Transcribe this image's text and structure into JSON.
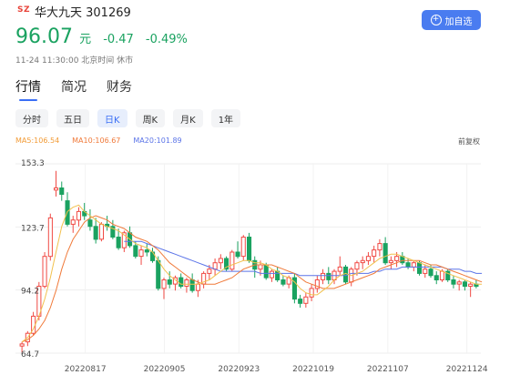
{
  "stock": {
    "exchange": "SZ",
    "name": "华大九天 301269",
    "price": "96.07",
    "unit": "元",
    "change": "-0.47",
    "change_pct": "-0.49%",
    "meta": "11-24 11:30:00 北京时间 休市",
    "add_watch_label": "加自选"
  },
  "main_tabs": [
    {
      "label": "行情",
      "active": true
    },
    {
      "label": "简况",
      "active": false
    },
    {
      "label": "财务",
      "active": false
    }
  ],
  "period_tabs": [
    {
      "label": "分时",
      "active": false
    },
    {
      "label": "五日",
      "active": false
    },
    {
      "label": "日K",
      "active": true
    },
    {
      "label": "周K",
      "active": false
    },
    {
      "label": "月K",
      "active": false
    },
    {
      "label": "1年",
      "active": false
    }
  ],
  "ma": {
    "ma5": "MA5:106.54",
    "ma10": "MA10:106.67",
    "ma20": "MA20:101.89",
    "adjust_label": "前复权"
  },
  "colors": {
    "up": "#f04a44",
    "down": "#1aa260",
    "ma5": "#f2c14e",
    "ma10": "#f07a3a",
    "ma20": "#5b74e8",
    "accent": "#3b6ff5"
  },
  "chart_data": {
    "type": "candlestick",
    "y_ticks": [
      "153.3",
      "123.7",
      "94.2",
      "64.7"
    ],
    "ylim": [
      64.7,
      153.3
    ],
    "x_ticks": [
      "20220817",
      "20220905",
      "20220923",
      "20221019",
      "20221107",
      "20221124"
    ],
    "candles": [
      {
        "o": 68,
        "h": 70,
        "l": 65,
        "c": 69
      },
      {
        "o": 70,
        "h": 75,
        "l": 68,
        "c": 74
      },
      {
        "o": 74,
        "h": 84,
        "l": 73,
        "c": 82
      },
      {
        "o": 82,
        "h": 98,
        "l": 80,
        "c": 96
      },
      {
        "o": 96,
        "h": 112,
        "l": 95,
        "c": 110
      },
      {
        "o": 110,
        "h": 130,
        "l": 108,
        "c": 128
      },
      {
        "o": 141,
        "h": 150,
        "l": 138,
        "c": 142
      },
      {
        "o": 142,
        "h": 145,
        "l": 136,
        "c": 139
      },
      {
        "o": 136,
        "h": 140,
        "l": 124,
        "c": 125
      },
      {
        "o": 125,
        "h": 129,
        "l": 121,
        "c": 127
      },
      {
        "o": 127,
        "h": 133,
        "l": 124,
        "c": 131
      },
      {
        "o": 131,
        "h": 135,
        "l": 127,
        "c": 129
      },
      {
        "o": 127,
        "h": 132,
        "l": 122,
        "c": 124
      },
      {
        "o": 124,
        "h": 128,
        "l": 116,
        "c": 118
      },
      {
        "o": 118,
        "h": 126,
        "l": 117,
        "c": 125
      },
      {
        "o": 125,
        "h": 129,
        "l": 122,
        "c": 124
      },
      {
        "o": 124,
        "h": 127,
        "l": 118,
        "c": 119
      },
      {
        "o": 119,
        "h": 123,
        "l": 113,
        "c": 114
      },
      {
        "o": 114,
        "h": 122,
        "l": 112,
        "c": 121
      },
      {
        "o": 121,
        "h": 124,
        "l": 114,
        "c": 115
      },
      {
        "o": 115,
        "h": 117,
        "l": 109,
        "c": 110
      },
      {
        "o": 110,
        "h": 115,
        "l": 106,
        "c": 113
      },
      {
        "o": 113,
        "h": 116,
        "l": 110,
        "c": 112
      },
      {
        "o": 112,
        "h": 114,
        "l": 107,
        "c": 108
      },
      {
        "o": 108,
        "h": 110,
        "l": 94,
        "c": 95
      },
      {
        "o": 95,
        "h": 100,
        "l": 90,
        "c": 99
      },
      {
        "o": 99,
        "h": 103,
        "l": 95,
        "c": 97
      },
      {
        "o": 97,
        "h": 101,
        "l": 94,
        "c": 100
      },
      {
        "o": 100,
        "h": 102,
        "l": 95,
        "c": 96
      },
      {
        "o": 96,
        "h": 100,
        "l": 93,
        "c": 99
      },
      {
        "o": 99,
        "h": 102,
        "l": 93,
        "c": 94
      },
      {
        "o": 94,
        "h": 99,
        "l": 91,
        "c": 97
      },
      {
        "o": 97,
        "h": 103,
        "l": 95,
        "c": 102
      },
      {
        "o": 102,
        "h": 106,
        "l": 99,
        "c": 104
      },
      {
        "o": 104,
        "h": 109,
        "l": 101,
        "c": 107
      },
      {
        "o": 107,
        "h": 111,
        "l": 104,
        "c": 109
      },
      {
        "o": 109,
        "h": 110,
        "l": 103,
        "c": 104
      },
      {
        "o": 104,
        "h": 113,
        "l": 103,
        "c": 112
      },
      {
        "o": 112,
        "h": 117,
        "l": 109,
        "c": 110
      },
      {
        "o": 110,
        "h": 120,
        "l": 108,
        "c": 119
      },
      {
        "o": 119,
        "h": 121,
        "l": 107,
        "c": 108
      },
      {
        "o": 108,
        "h": 110,
        "l": 100,
        "c": 104
      },
      {
        "o": 104,
        "h": 108,
        "l": 101,
        "c": 106
      },
      {
        "o": 106,
        "h": 107,
        "l": 99,
        "c": 100
      },
      {
        "o": 100,
        "h": 104,
        "l": 98,
        "c": 103
      },
      {
        "o": 103,
        "h": 105,
        "l": 98,
        "c": 99
      },
      {
        "o": 99,
        "h": 101,
        "l": 96,
        "c": 97
      },
      {
        "o": 97,
        "h": 101,
        "l": 95,
        "c": 100
      },
      {
        "o": 100,
        "h": 102,
        "l": 88,
        "c": 90
      },
      {
        "o": 90,
        "h": 92,
        "l": 86,
        "c": 88
      },
      {
        "o": 88,
        "h": 93,
        "l": 86,
        "c": 91
      },
      {
        "o": 91,
        "h": 97,
        "l": 89,
        "c": 95
      },
      {
        "o": 95,
        "h": 101,
        "l": 93,
        "c": 99
      },
      {
        "o": 99,
        "h": 104,
        "l": 97,
        "c": 102
      },
      {
        "o": 102,
        "h": 105,
        "l": 97,
        "c": 99
      },
      {
        "o": 99,
        "h": 104,
        "l": 97,
        "c": 103
      },
      {
        "o": 103,
        "h": 110,
        "l": 101,
        "c": 105
      },
      {
        "o": 105,
        "h": 106,
        "l": 97,
        "c": 98
      },
      {
        "o": 98,
        "h": 105,
        "l": 96,
        "c": 104
      },
      {
        "o": 104,
        "h": 108,
        "l": 101,
        "c": 107
      },
      {
        "o": 107,
        "h": 110,
        "l": 104,
        "c": 108
      },
      {
        "o": 108,
        "h": 112,
        "l": 106,
        "c": 110
      },
      {
        "o": 110,
        "h": 115,
        "l": 107,
        "c": 113
      },
      {
        "o": 113,
        "h": 118,
        "l": 110,
        "c": 116
      },
      {
        "o": 116,
        "h": 119,
        "l": 106,
        "c": 107
      },
      {
        "o": 107,
        "h": 110,
        "l": 104,
        "c": 108
      },
      {
        "o": 108,
        "h": 112,
        "l": 105,
        "c": 110
      },
      {
        "o": 110,
        "h": 112,
        "l": 106,
        "c": 107
      },
      {
        "o": 107,
        "h": 109,
        "l": 104,
        "c": 105
      },
      {
        "o": 105,
        "h": 108,
        "l": 103,
        "c": 107
      },
      {
        "o": 107,
        "h": 108,
        "l": 101,
        "c": 102
      },
      {
        "o": 102,
        "h": 106,
        "l": 100,
        "c": 104
      },
      {
        "o": 104,
        "h": 106,
        "l": 100,
        "c": 101
      },
      {
        "o": 101,
        "h": 103,
        "l": 97,
        "c": 99
      },
      {
        "o": 99,
        "h": 104,
        "l": 98,
        "c": 103
      },
      {
        "o": 103,
        "h": 104,
        "l": 98,
        "c": 99
      },
      {
        "o": 99,
        "h": 101,
        "l": 95,
        "c": 97
      },
      {
        "o": 97,
        "h": 99,
        "l": 94,
        "c": 98
      },
      {
        "o": 98,
        "h": 99,
        "l": 94,
        "c": 96
      },
      {
        "o": 96,
        "h": 98,
        "l": 91,
        "c": 97
      },
      {
        "o": 97,
        "h": 99,
        "l": 95,
        "c": 96
      }
    ],
    "ma5": [
      70,
      72,
      76,
      82,
      90,
      100,
      112,
      124,
      131,
      133,
      134,
      131,
      129,
      127,
      125,
      124,
      123,
      122,
      120,
      118,
      116,
      115,
      114,
      112,
      108,
      104,
      101,
      99,
      97,
      97,
      97,
      97,
      98,
      99,
      101,
      103,
      105,
      106,
      107,
      108,
      108,
      107,
      107,
      106,
      104,
      103,
      101,
      100,
      98,
      95,
      93,
      92,
      92,
      94,
      96,
      99,
      101,
      102,
      101,
      102,
      103,
      105,
      107,
      109,
      110,
      111,
      111,
      110,
      109,
      108,
      107,
      106,
      105,
      104,
      103,
      102,
      101,
      100,
      99,
      98,
      97,
      97
    ],
    "ma10": [
      70,
      71,
      73,
      76,
      80,
      86,
      94,
      104,
      112,
      118,
      122,
      126,
      128,
      129,
      128,
      127,
      125,
      124,
      123,
      121,
      119,
      118,
      117,
      115,
      113,
      110,
      107,
      105,
      103,
      101,
      99,
      98,
      97,
      97,
      97,
      98,
      99,
      100,
      102,
      104,
      105,
      106,
      106,
      106,
      106,
      105,
      104,
      103,
      102,
      100,
      98,
      97,
      96,
      95,
      95,
      95,
      96,
      97,
      98,
      99,
      100,
      101,
      102,
      104,
      105,
      106,
      107,
      108,
      108,
      108,
      108,
      107,
      106,
      106,
      105,
      104,
      103,
      102,
      101,
      100,
      99,
      98
    ],
    "ma20": [
      null,
      null,
      null,
      null,
      null,
      null,
      null,
      null,
      null,
      null,
      null,
      null,
      null,
      null,
      null,
      null,
      null,
      null,
      117,
      117,
      117,
      117,
      116,
      115,
      114,
      113,
      112,
      111,
      110,
      109,
      108,
      107,
      106,
      105,
      104,
      103,
      103,
      103,
      103,
      103,
      103,
      103,
      102,
      102,
      102,
      102,
      102,
      102,
      102,
      101,
      101,
      101,
      101,
      101,
      101,
      101,
      101,
      101,
      102,
      102,
      102,
      102,
      103,
      103,
      104,
      104,
      104,
      105,
      105,
      105,
      105,
      105,
      105,
      105,
      105,
      104,
      104,
      104,
      103,
      103,
      102,
      102
    ]
  }
}
